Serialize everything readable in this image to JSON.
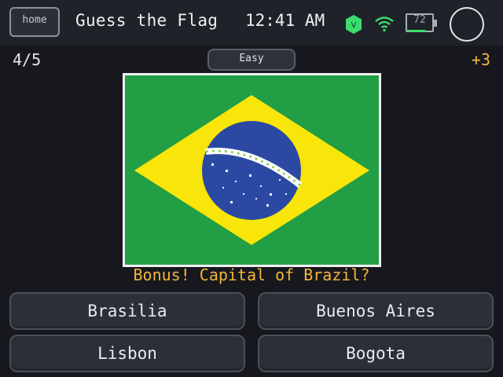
{
  "status_bar": {
    "home_label": "home",
    "app_title": "Guess the Flag",
    "clock": "12:41 AM",
    "vpn_badge": "V",
    "battery_percent": "72",
    "icons": [
      "home-button",
      "vpn-icon",
      "wifi-icon",
      "battery-icon",
      "power-icon"
    ]
  },
  "game": {
    "progress": "4/5",
    "difficulty": "Easy",
    "score_delta": "+3",
    "flag_country": "Brazil",
    "question": "Bonus! Capital of Brazil?",
    "answers": [
      "Brasilia",
      "Buenos Aires",
      "Lisbon",
      "Bogota"
    ]
  },
  "colors": {
    "background": "#16181d",
    "accent": "#f3b63b",
    "flag_green": "#229e45",
    "flag_yellow": "#f8e509",
    "flag_blue": "#2b49a3",
    "battery_fill": "#3ddc6f",
    "vpn_green": "#3ddc6f"
  }
}
